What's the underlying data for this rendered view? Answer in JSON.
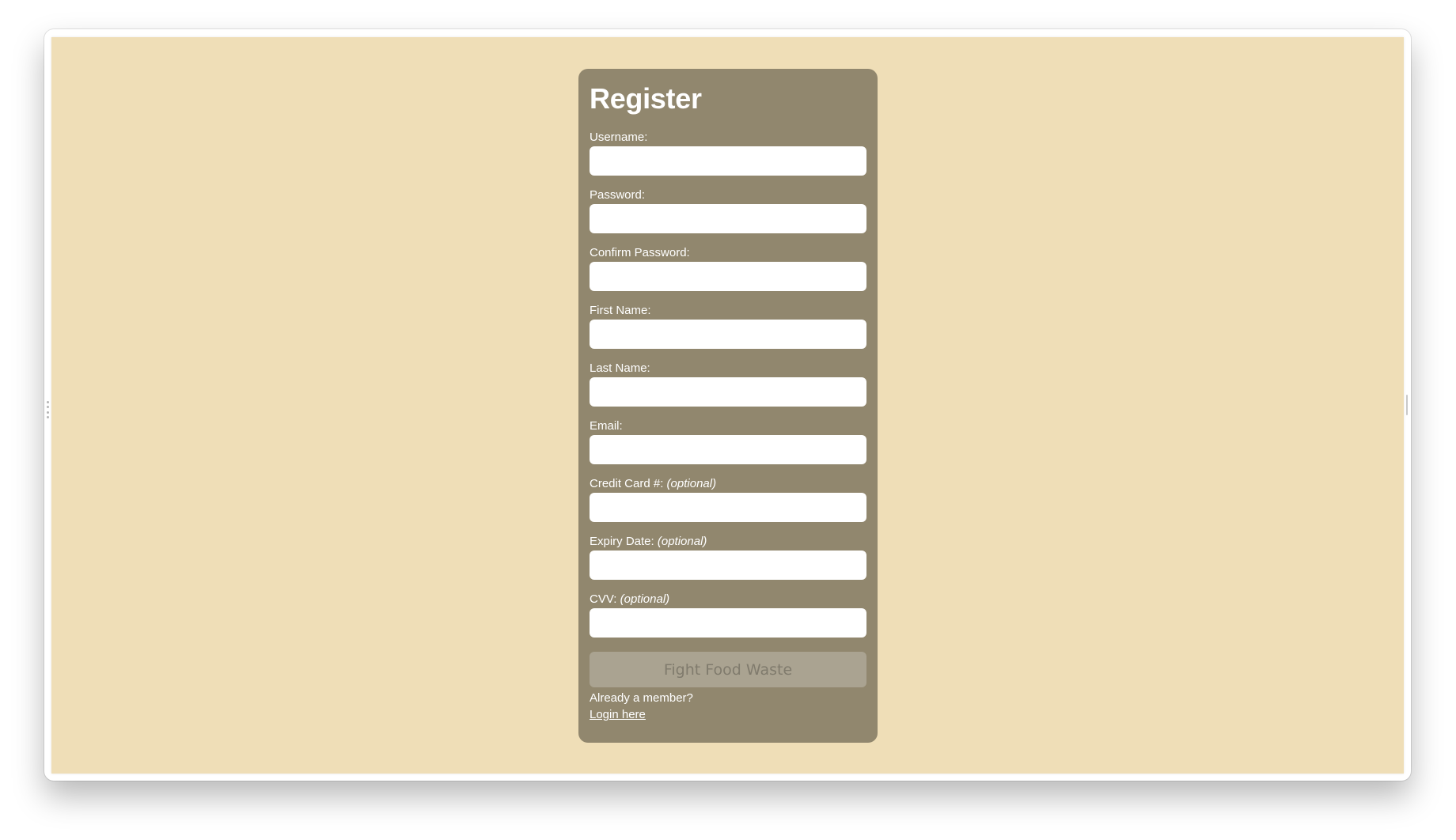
{
  "form": {
    "title": "Register",
    "fields": [
      {
        "label": "Username:",
        "optional": "",
        "value": ""
      },
      {
        "label": "Password:",
        "optional": "",
        "value": ""
      },
      {
        "label": "Confirm Password:",
        "optional": "",
        "value": ""
      },
      {
        "label": "First Name:",
        "optional": "",
        "value": ""
      },
      {
        "label": "Last Name:",
        "optional": "",
        "value": ""
      },
      {
        "label": "Email:",
        "optional": "",
        "value": ""
      },
      {
        "label": "Credit Card #:",
        "optional": "(optional)",
        "value": ""
      },
      {
        "label": "Expiry Date:",
        "optional": "(optional)",
        "value": ""
      },
      {
        "label": "CVV:",
        "optional": "(optional)",
        "value": ""
      }
    ],
    "submit_label": "Fight Food Waste",
    "member_prompt": "Already a member?",
    "login_link": "Login here"
  },
  "colors": {
    "page_background": "#efdeb7",
    "card_background": "#91876e",
    "button_background": "#aaa391",
    "button_text": "#807b6d"
  }
}
